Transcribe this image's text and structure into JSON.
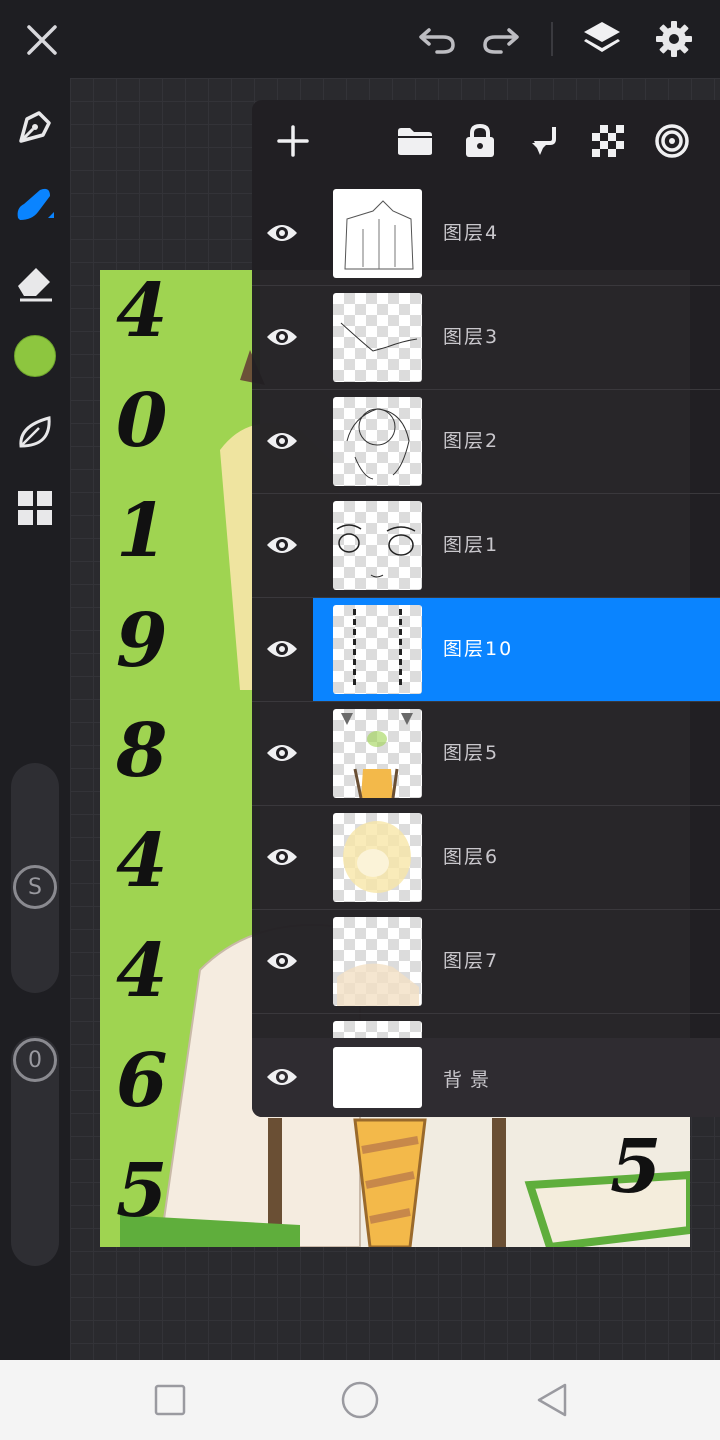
{
  "artwork_digits_left": [
    "4",
    "0",
    "1",
    "9",
    "8",
    "4",
    "4",
    "6",
    "5"
  ],
  "artwork_digit_right": "5",
  "colors": {
    "accent": "#0a84ff",
    "current_color": "#9fd451",
    "background": "#1e1e22",
    "panel": "#211f23"
  },
  "sliders": [
    {
      "label": "S"
    },
    {
      "label": "0"
    }
  ],
  "layers_panel": {
    "toolbar_icons": [
      "add-icon",
      "folder-icon",
      "lock-icon",
      "merge-down-icon",
      "checkerboard-icon",
      "reference-icon"
    ],
    "layers": [
      {
        "name": "图层4",
        "visible": true,
        "selected": false
      },
      {
        "name": "图层3",
        "visible": true,
        "selected": false
      },
      {
        "name": "图层2",
        "visible": true,
        "selected": false
      },
      {
        "name": "图层1",
        "visible": true,
        "selected": false
      },
      {
        "name": "图层10",
        "visible": true,
        "selected": true
      },
      {
        "name": "图层5",
        "visible": true,
        "selected": false
      },
      {
        "name": "图层6",
        "visible": true,
        "selected": false
      },
      {
        "name": "图层7",
        "visible": true,
        "selected": false
      }
    ],
    "background_layer": {
      "name": "背景",
      "visible": true
    }
  }
}
